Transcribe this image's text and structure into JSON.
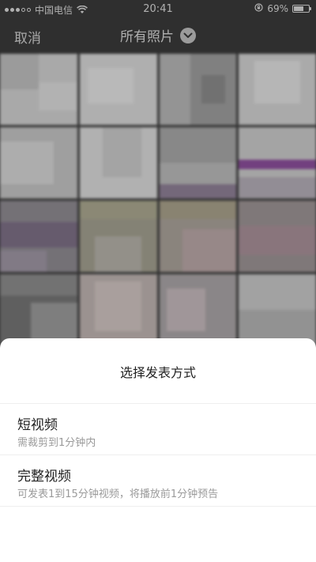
{
  "status_bar": {
    "carrier": "中国电信",
    "time": "20:41",
    "battery_text": "69%",
    "battery_level": 0.69
  },
  "nav": {
    "cancel_label": "取消",
    "album_title": "所有照片"
  },
  "sheet": {
    "title": "选择发表方式",
    "options": [
      {
        "title": "短视频",
        "desc": "需裁剪到1分钟内"
      },
      {
        "title": "完整视频",
        "desc": "可发表1到15分钟视频，将播放前1分钟预告"
      }
    ]
  },
  "colors": {
    "sheet_bg": "#ffffff",
    "title_text": "#222222",
    "desc_text": "#9a9a9a"
  }
}
